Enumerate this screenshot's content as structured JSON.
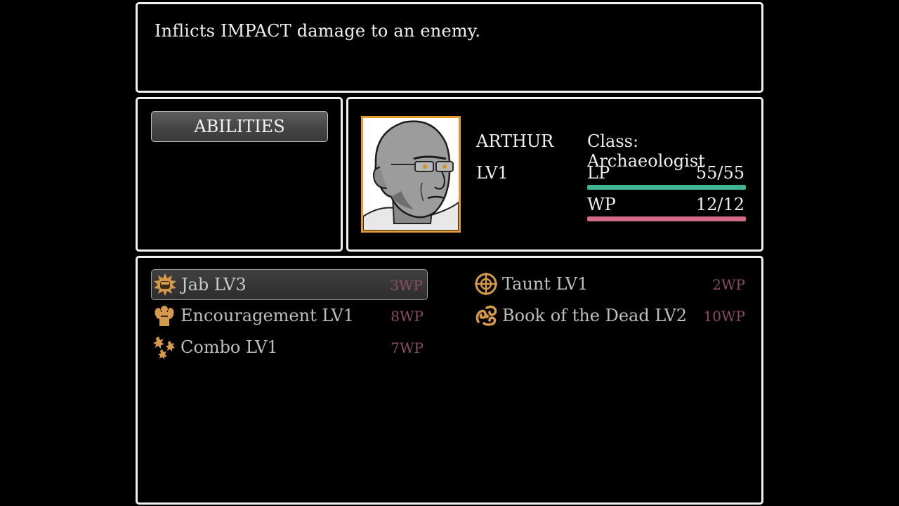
{
  "help": {
    "text": "Inflicts IMPACT damage to an enemy."
  },
  "command_menu": {
    "items": [
      {
        "label": "ABILITIES",
        "selected": true
      }
    ]
  },
  "actor": {
    "name": "ARTHUR",
    "level": "LV1",
    "class_text": "Class: Archaeologist",
    "lp": {
      "label": "LP",
      "value": "55/55",
      "current": 55,
      "max": 55,
      "color": "#3fb596"
    },
    "wp": {
      "label": "WP",
      "value": "12/12",
      "current": 12,
      "max": 12,
      "color": "#d46a8a"
    },
    "portrait_frame_color": "#e59a2e"
  },
  "skills": [
    {
      "name": "Jab LV3",
      "cost": "3WP",
      "icon": "fist-impact-icon",
      "selected": true
    },
    {
      "name": "Taunt LV1",
      "cost": "2WP",
      "icon": "crosshair-icon",
      "selected": false
    },
    {
      "name": "Encouragement LV1",
      "cost": "8WP",
      "icon": "flexing-muscle-icon",
      "selected": false
    },
    {
      "name": "Book of the Dead LV2",
      "cost": "10WP",
      "icon": "ankh-scroll-icon",
      "selected": false
    },
    {
      "name": "Combo LV1",
      "cost": "7WP",
      "icon": "multi-burst-icon",
      "selected": false
    }
  ],
  "colors": {
    "window_border": "#f1f1f1",
    "icon_gold": "#d49a4a",
    "cost_text": "#8a4d61"
  }
}
